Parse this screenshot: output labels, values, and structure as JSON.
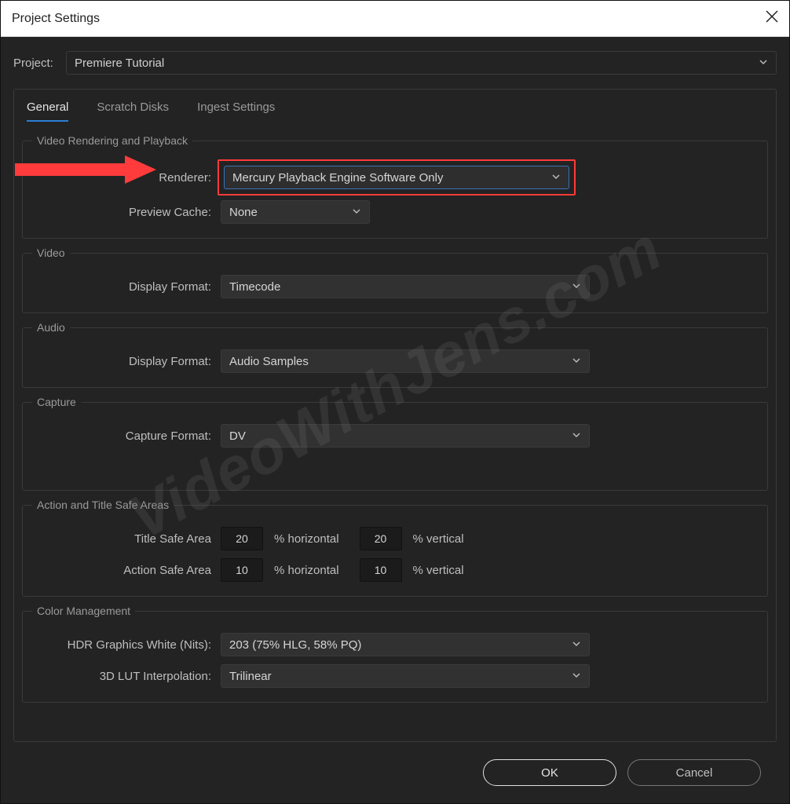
{
  "window": {
    "title": "Project Settings"
  },
  "project": {
    "label": "Project:",
    "value": "Premiere Tutorial"
  },
  "tabs": {
    "general": "General",
    "scratch": "Scratch Disks",
    "ingest": "Ingest Settings"
  },
  "groups": {
    "rendering": {
      "legend": "Video Rendering and Playback",
      "renderer_label": "Renderer:",
      "renderer_value": "Mercury Playback Engine Software Only",
      "preview_label": "Preview Cache:",
      "preview_value": "None"
    },
    "video": {
      "legend": "Video",
      "display_label": "Display Format:",
      "display_value": "Timecode"
    },
    "audio": {
      "legend": "Audio",
      "display_label": "Display Format:",
      "display_value": "Audio Samples"
    },
    "capture": {
      "legend": "Capture",
      "format_label": "Capture Format:",
      "format_value": "DV"
    },
    "safe": {
      "legend": "Action and Title Safe Areas",
      "title_label": "Title Safe Area",
      "title_h": "20",
      "title_v": "20",
      "action_label": "Action Safe Area",
      "action_h": "10",
      "action_v": "10",
      "pct_h": "% horizontal",
      "pct_v": "% vertical"
    },
    "color": {
      "legend": "Color Management",
      "hdr_label": "HDR Graphics White (Nits):",
      "hdr_value": "203 (75% HLG, 58% PQ)",
      "lut_label": "3D LUT Interpolation:",
      "lut_value": "Trilinear"
    }
  },
  "buttons": {
    "ok": "OK",
    "cancel": "Cancel"
  },
  "watermark": "VideoWithJens.com"
}
